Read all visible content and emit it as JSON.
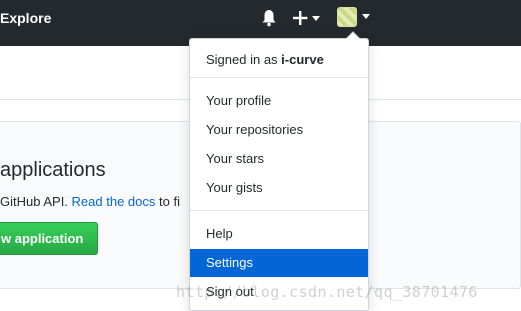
{
  "header": {
    "explore_label": "Explore",
    "icons": [
      "bell-icon",
      "plus-icon",
      "chevron-down-icon",
      "avatar-icon"
    ]
  },
  "page": {
    "title": "applications",
    "desc_before": "GitHub API. ",
    "docs_link": "Read the docs",
    "desc_after": " to fi",
    "new_app_button": "w application"
  },
  "menu": {
    "signed_prefix": "Signed in as ",
    "username": "i-curve",
    "items": [
      {
        "label": "Your profile"
      },
      {
        "label": "Your repositories"
      },
      {
        "label": "Your stars"
      },
      {
        "label": "Your gists"
      },
      {
        "label": "Help"
      },
      {
        "label": "Settings",
        "active": true
      },
      {
        "label": "Sign out"
      }
    ]
  },
  "watermark": "http://blog.csdn.net/qq_38701476",
  "colors": {
    "header_bg": "#24292e",
    "accent": "#0366d6",
    "button_green": "#28a745"
  }
}
